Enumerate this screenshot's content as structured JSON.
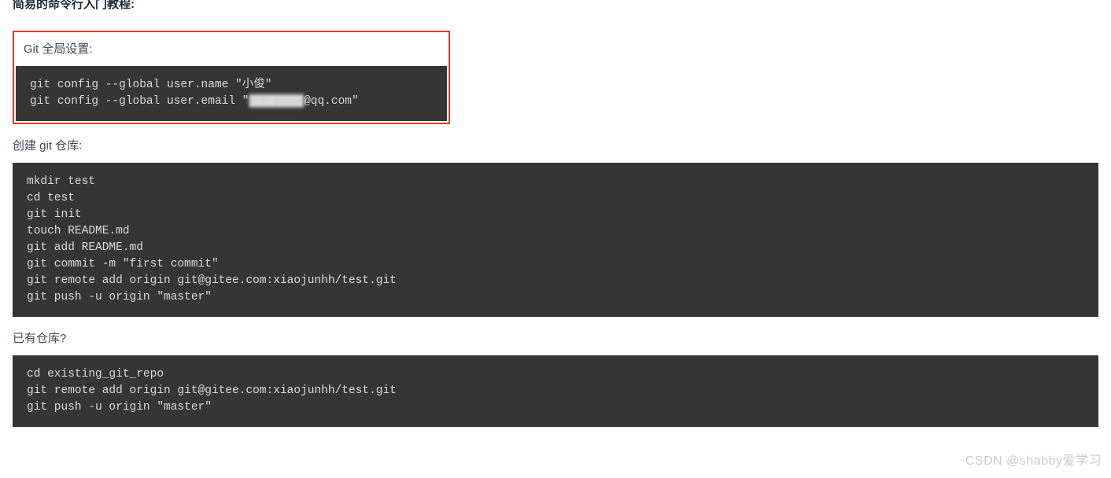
{
  "page_title": "简易的命令行入门教程:",
  "sections": {
    "global_settings": {
      "heading": "Git 全局设置:",
      "code_prefix": "git config --global user.name \"小俊\"\ngit config --global user.email \"",
      "redacted": "████████",
      "code_suffix": "@qq.com\""
    },
    "create_repo": {
      "heading": "创建 git 仓库:",
      "code": "mkdir test\ncd test\ngit init\ntouch README.md\ngit add README.md\ngit commit -m \"first commit\"\ngit remote add origin git@gitee.com:xiaojunhh/test.git\ngit push -u origin \"master\""
    },
    "existing_repo": {
      "heading": "已有仓库?",
      "code": "cd existing_git_repo\ngit remote add origin git@gitee.com:xiaojunhh/test.git\ngit push -u origin \"master\""
    }
  },
  "watermark": "CSDN @shabby爱学习"
}
